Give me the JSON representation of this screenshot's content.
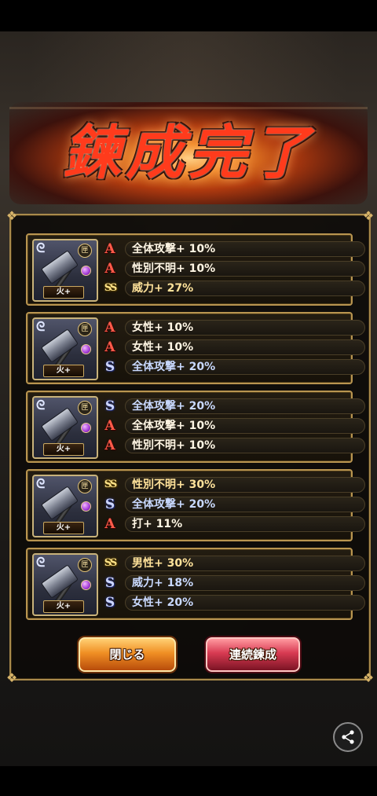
{
  "title": "鍊成完了",
  "cards": [
    {
      "element": "火+",
      "medal": "匣",
      "stats": [
        {
          "rank": "A",
          "text": "全体攻撃+ 10%"
        },
        {
          "rank": "A",
          "text": "性別不明+ 10%"
        },
        {
          "rank": "SS",
          "text": "威力+ 27%"
        }
      ]
    },
    {
      "element": "火+",
      "medal": "匣",
      "stats": [
        {
          "rank": "A",
          "text": "女性+ 10%"
        },
        {
          "rank": "A",
          "text": "女性+ 10%"
        },
        {
          "rank": "S",
          "text": "全体攻撃+ 20%"
        }
      ]
    },
    {
      "element": "火+",
      "medal": "匣",
      "stats": [
        {
          "rank": "S",
          "text": "全体攻撃+ 20%"
        },
        {
          "rank": "A",
          "text": "全体攻撃+ 10%"
        },
        {
          "rank": "A",
          "text": "性別不明+ 10%"
        }
      ]
    },
    {
      "element": "火+",
      "medal": "匣",
      "stats": [
        {
          "rank": "SS",
          "text": "性別不明+ 30%"
        },
        {
          "rank": "S",
          "text": "全体攻撃+ 20%"
        },
        {
          "rank": "A",
          "text": "打+ 11%"
        }
      ]
    },
    {
      "element": "火+",
      "medal": "匣",
      "stats": [
        {
          "rank": "SS",
          "text": "男性+ 30%"
        },
        {
          "rank": "S",
          "text": "威力+ 18%"
        },
        {
          "rank": "S",
          "text": "女性+ 20%"
        }
      ]
    }
  ],
  "rank_glyphs": {
    "A": "A",
    "S": "S",
    "SS": "SS"
  },
  "buttons": {
    "close": "閉じる",
    "continue": "連続鍊成"
  },
  "icons": {
    "share": "share-icon",
    "weapon": "hammer-icon"
  },
  "colors": {
    "rank_A": "#ff5b4a",
    "rank_S": "#cfd8ff",
    "rank_SS": "#ffe38a",
    "frame": "#b99550"
  }
}
